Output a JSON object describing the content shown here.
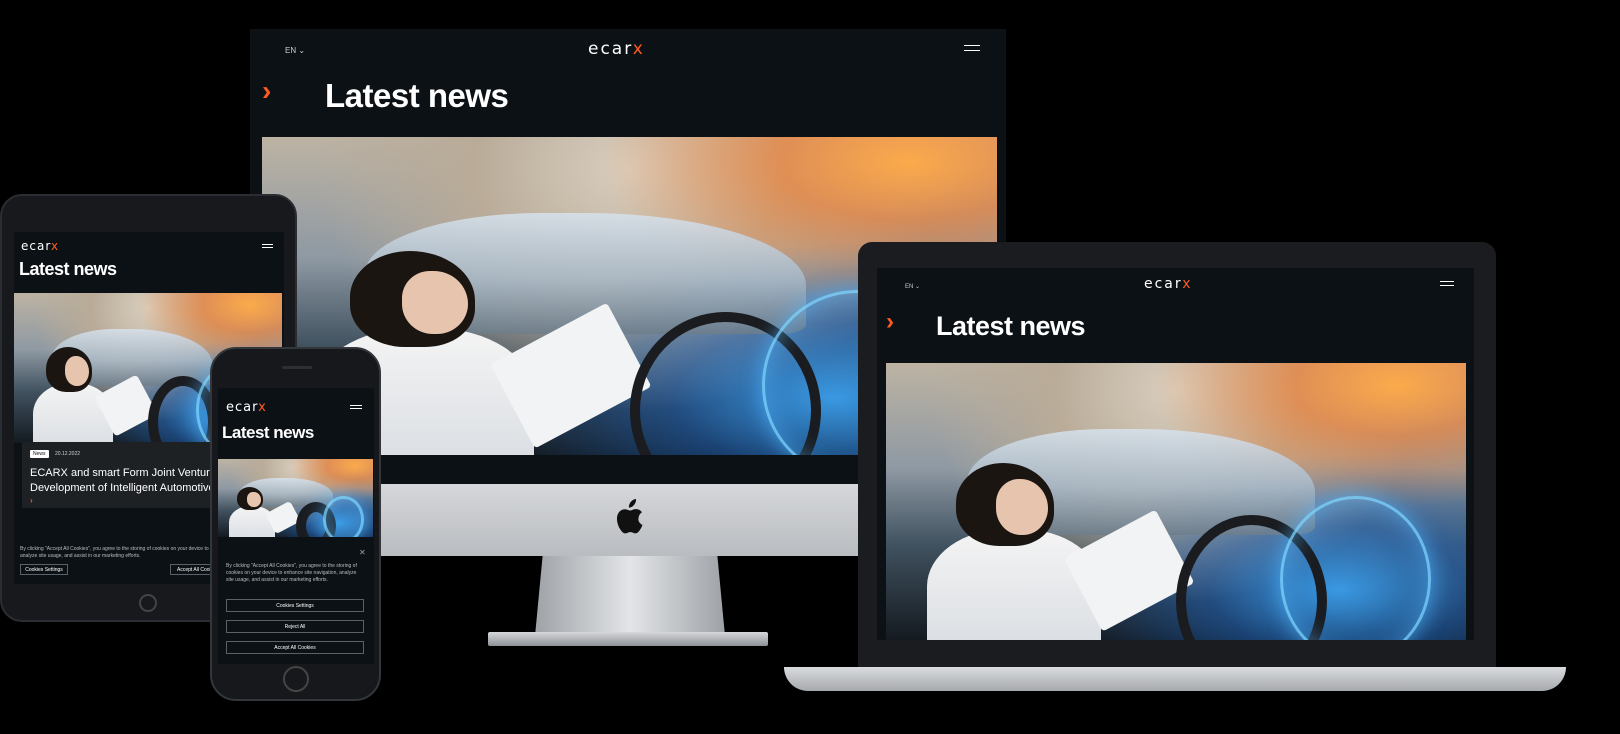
{
  "brand": {
    "logo_main": "ecar",
    "logo_accent": "x",
    "accent_color": "#ff5a1f"
  },
  "imac": {
    "lang": "EN",
    "heading": "Latest news"
  },
  "laptop": {
    "lang": "EN",
    "heading": "Latest news"
  },
  "tablet": {
    "heading": "Latest news",
    "card": {
      "tag": "News",
      "date": "20.12.2022",
      "title_line1": "ECARX and smart Form Joint Venture to",
      "title_line2": "Development of Intelligent Automotive"
    },
    "cookie_text": "By clicking \"Accept All Cookies\", you agree to the storing of cookies on your device to enhance site navigation, analyze site usage, and assist in our marketing efforts.",
    "cookies_settings": "Cookies Settings",
    "accept_all": "Accept All Cookies"
  },
  "phone": {
    "heading": "Latest news",
    "cookie_text": "By clicking \"Accept All Cookies\", you agree to the storing of cookies on your device to enhance site navigation, analyze site usage, and assist in our marketing efforts.",
    "cookies_settings": "Cookies Settings",
    "reject_all": "Reject All",
    "accept_all": "Accept All Cookies"
  }
}
